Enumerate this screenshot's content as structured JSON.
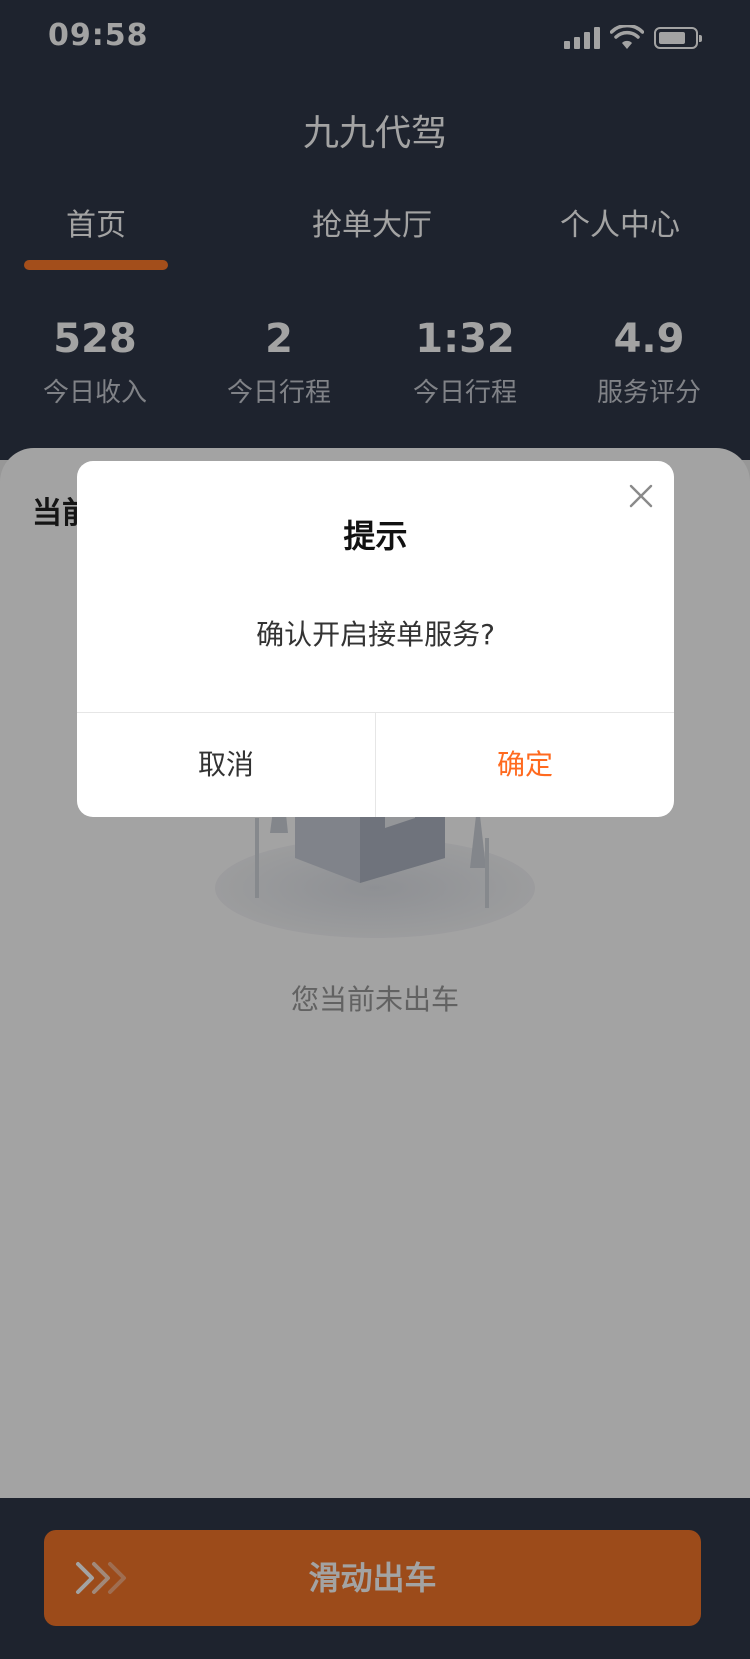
{
  "status_bar": {
    "time": "09:58"
  },
  "app": {
    "title": "九九代驾"
  },
  "tabs": [
    {
      "label": "首页",
      "active": true
    },
    {
      "label": "抢单大厅",
      "active": false
    },
    {
      "label": "个人中心",
      "active": false
    }
  ],
  "stats": [
    {
      "value": "528",
      "label": "今日收入"
    },
    {
      "value": "2",
      "label": "今日行程"
    },
    {
      "value": "1:32",
      "label": "今日行程"
    },
    {
      "value": "4.9",
      "label": "服务评分"
    }
  ],
  "panel": {
    "title": "当前",
    "empty_text": "您当前未出车"
  },
  "footer": {
    "slide_label": "滑动出车"
  },
  "dialog": {
    "title": "提示",
    "message": "确认开启接单服务?",
    "cancel_label": "取消",
    "confirm_label": "确定"
  },
  "colors": {
    "accent": "#f5762a",
    "header_bg": "#2f3748",
    "confirm_text": "#ff6a1f"
  },
  "icons": {
    "close": "close-icon",
    "slide": "chevron-right-triple-icon",
    "signal": "signal-icon",
    "wifi": "wifi-icon",
    "battery": "battery-icon"
  }
}
